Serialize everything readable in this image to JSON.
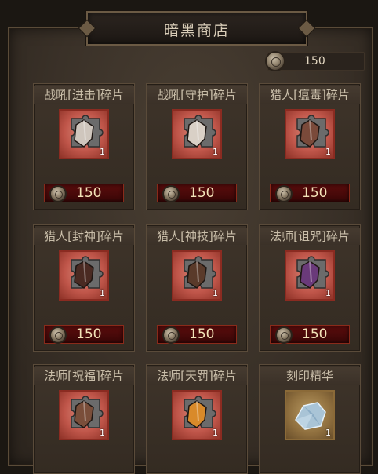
{
  "shop": {
    "title": "暗黑商店",
    "currency": {
      "icon": "silver-coin-icon",
      "amount": "150"
    }
  },
  "items": [
    {
      "name": "战吼[进击]碎片",
      "qty": "1",
      "price": "150",
      "icon": "fragment-icon"
    },
    {
      "name": "战吼[守护]碎片",
      "qty": "1",
      "price": "150",
      "icon": "fragment-icon"
    },
    {
      "name": "猎人[瘟毒]碎片",
      "qty": "1",
      "price": "150",
      "icon": "fragment-icon"
    },
    {
      "name": "猎人[封神]碎片",
      "qty": "1",
      "price": "150",
      "icon": "fragment-icon"
    },
    {
      "name": "猎人[神技]碎片",
      "qty": "1",
      "price": "150",
      "icon": "fragment-icon"
    },
    {
      "name": "法师[诅咒]碎片",
      "qty": "1",
      "price": "150",
      "icon": "fragment-icon"
    },
    {
      "name": "法师[祝福]碎片",
      "qty": "1",
      "icon": "fragment-icon"
    },
    {
      "name": "法师[天罚]碎片",
      "qty": "1",
      "icon": "fragment-icon"
    },
    {
      "name": "刻印精华",
      "qty": "1",
      "icon": "crystal-icon"
    }
  ],
  "colors": {
    "panel_bg": "#3a3128",
    "price_button": "#5a0c0c",
    "icon_frame_red": "#c0564a",
    "gem_colors": [
      "#cfc6bd",
      "#d9d0c6",
      "#7a4a3a",
      "#4a2a22",
      "#5a3a2a",
      "#6a3a7a",
      "#7a4e3a",
      "#d98a2a",
      "#a9c4d6"
    ]
  }
}
